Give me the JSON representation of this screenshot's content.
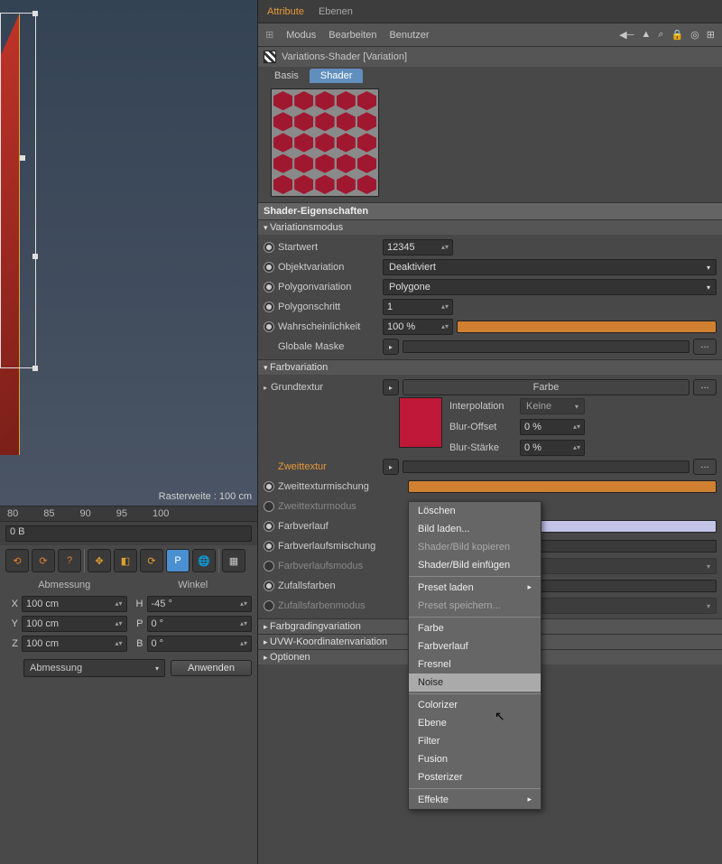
{
  "viewport": {
    "raster_label": "Rasterweite : 100 cm"
  },
  "ruler": {
    "ticks": [
      "80",
      "85",
      "90",
      "95",
      "100"
    ]
  },
  "fieldbar": {
    "value": "0 B"
  },
  "coords": {
    "head1": "Abmessung",
    "head2": "Winkel",
    "x_label": "X",
    "x_val": "100 cm",
    "h_label": "H",
    "h_val": "-45 °",
    "y_label": "Y",
    "y_val": "100 cm",
    "p_label": "P",
    "p_val": "0 °",
    "z_label": "Z",
    "z_val": "100 cm",
    "b_label": "B",
    "b_val": "0 °",
    "mode": "Abmessung",
    "apply": "Anwenden"
  },
  "tabs": {
    "attribute": "Attribute",
    "ebenen": "Ebenen"
  },
  "menubar": {
    "modus": "Modus",
    "bearbeiten": "Bearbeiten",
    "benutzer": "Benutzer"
  },
  "object_header": "Variations-Shader [Variation]",
  "subtabs": {
    "basis": "Basis",
    "shader": "Shader"
  },
  "sections": {
    "shader_props": "Shader-Eigenschaften"
  },
  "groups": {
    "variationsmodus": "Variationsmodus",
    "farbvariation": "Farbvariation",
    "farbgrading": "Farbgradingvariation",
    "uvw": "UVW-Koordinatenvariation",
    "optionen": "Optionen"
  },
  "props": {
    "startwert_label": "Startwert",
    "startwert_val": "12345",
    "objektvar_label": "Objektvariation",
    "objektvar_val": "Deaktiviert",
    "polyvar_label": "Polygonvariation",
    "polyvar_val": "Polygone",
    "polystep_label": "Polygonschritt",
    "polystep_val": "1",
    "wahr_label": "Wahrscheinlichkeit",
    "wahr_val": "100 %",
    "globmask_label": "Globale Maske",
    "grundtextur_label": "Grundtextur",
    "grundtextur_btn": "Farbe",
    "interp_label": "Interpolation",
    "interp_val": "Keine",
    "bluroff_label": "Blur-Offset",
    "bluroff_val": "0 %",
    "blurst_label": "Blur-Stärke",
    "blurst_val": "0 %",
    "zweittextur_label": "Zweittextur",
    "zweitmix_label": "Zweittexturmischung",
    "zweitmodus_label": "Zweittexturmodus",
    "farbverlauf_label": "Farbverlauf",
    "farbverlaufmix_label": "Farbverlaufsmischung",
    "farbverlaufmodus_label": "Farbverlaufsmodus",
    "zufall_label": "Zufallsfarben",
    "zufallmodus_label": "Zufallsfarbenmodus"
  },
  "context_menu": {
    "loeschen": "Löschen",
    "bild_laden": "Bild laden...",
    "shader_kopieren": "Shader/Bild kopieren",
    "shader_einfuegen": "Shader/Bild einfügen",
    "preset_laden": "Preset laden",
    "preset_speichern": "Preset speichern...",
    "farbe": "Farbe",
    "farbverlauf": "Farbverlauf",
    "fresnel": "Fresnel",
    "noise": "Noise",
    "colorizer": "Colorizer",
    "ebene": "Ebene",
    "filter": "Filter",
    "fusion": "Fusion",
    "posterizer": "Posterizer",
    "effekte": "Effekte"
  }
}
